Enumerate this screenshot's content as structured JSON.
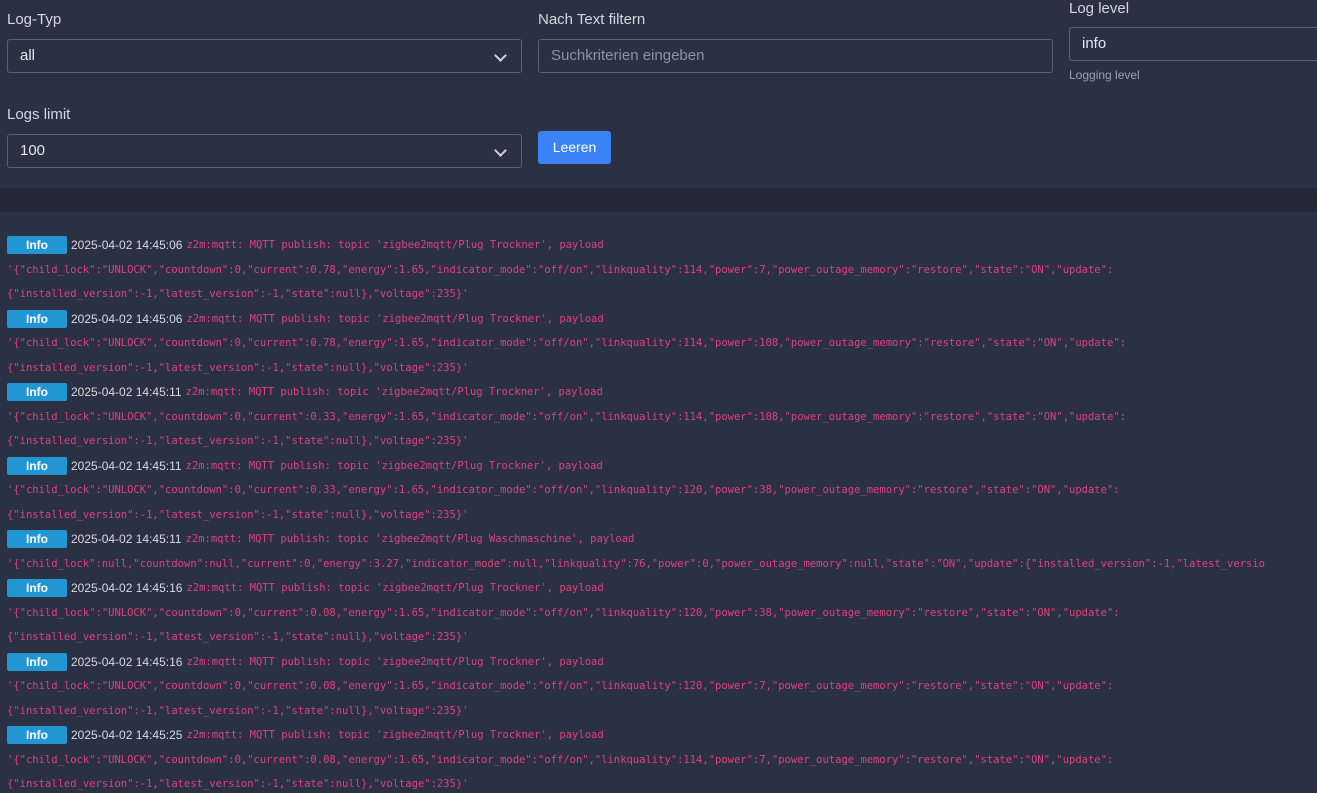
{
  "filters": {
    "log_type": {
      "label": "Log-Typ",
      "value": "all"
    },
    "text_filter": {
      "label": "Nach Text filtern",
      "placeholder": "Suchkriterien eingeben"
    },
    "log_level": {
      "label": "Log level",
      "value": "info",
      "help": "Logging level"
    },
    "logs_limit": {
      "label": "Logs limit",
      "value": "100"
    },
    "clear_button": "Leeren"
  },
  "logs": [
    {
      "level": "Info",
      "time": "2025-04-02 14:45:06",
      "message": "z2m:mqtt: MQTT publish: topic 'zigbee2mqtt/Plug Trockner', payload",
      "payload1": "'{\"child_lock\":\"UNLOCK\",\"countdown\":0,\"current\":0.78,\"energy\":1.65,\"indicator_mode\":\"off/on\",\"linkquality\":114,\"power\":7,\"power_outage_memory\":\"restore\",\"state\":\"ON\",\"update\":",
      "payload2": "{\"installed_version\":-1,\"latest_version\":-1,\"state\":null},\"voltage\":235}'"
    },
    {
      "level": "Info",
      "time": "2025-04-02 14:45:06",
      "message": "z2m:mqtt: MQTT publish: topic 'zigbee2mqtt/Plug Trockner', payload",
      "payload1": "'{\"child_lock\":\"UNLOCK\",\"countdown\":0,\"current\":0.78,\"energy\":1.65,\"indicator_mode\":\"off/on\",\"linkquality\":114,\"power\":108,\"power_outage_memory\":\"restore\",\"state\":\"ON\",\"update\":",
      "payload2": "{\"installed_version\":-1,\"latest_version\":-1,\"state\":null},\"voltage\":235}'"
    },
    {
      "level": "Info",
      "time": "2025-04-02 14:45:11",
      "message": "z2m:mqtt: MQTT publish: topic 'zigbee2mqtt/Plug Trockner', payload",
      "payload1": "'{\"child_lock\":\"UNLOCK\",\"countdown\":0,\"current\":0.33,\"energy\":1.65,\"indicator_mode\":\"off/on\",\"linkquality\":114,\"power\":108,\"power_outage_memory\":\"restore\",\"state\":\"ON\",\"update\":",
      "payload2": "{\"installed_version\":-1,\"latest_version\":-1,\"state\":null},\"voltage\":235}'"
    },
    {
      "level": "Info",
      "time": "2025-04-02 14:45:11",
      "message": "z2m:mqtt: MQTT publish: topic 'zigbee2mqtt/Plug Trockner', payload",
      "payload1": "'{\"child_lock\":\"UNLOCK\",\"countdown\":0,\"current\":0.33,\"energy\":1.65,\"indicator_mode\":\"off/on\",\"linkquality\":120,\"power\":38,\"power_outage_memory\":\"restore\",\"state\":\"ON\",\"update\":",
      "payload2": "{\"installed_version\":-1,\"latest_version\":-1,\"state\":null},\"voltage\":235}'"
    },
    {
      "level": "Info",
      "time": "2025-04-02 14:45:11",
      "message": "z2m:mqtt: MQTT publish: topic 'zigbee2mqtt/Plug Waschmaschine', payload",
      "payload1": "'{\"child_lock\":null,\"countdown\":null,\"current\":0,\"energy\":3.27,\"indicator_mode\":null,\"linkquality\":76,\"power\":0,\"power_outage_memory\":null,\"state\":\"ON\",\"update\":{\"installed_version\":-1,\"latest_versio",
      "payload2": ""
    },
    {
      "level": "Info",
      "time": "2025-04-02 14:45:16",
      "message": "z2m:mqtt: MQTT publish: topic 'zigbee2mqtt/Plug Trockner', payload",
      "payload1": "'{\"child_lock\":\"UNLOCK\",\"countdown\":0,\"current\":0.08,\"energy\":1.65,\"indicator_mode\":\"off/on\",\"linkquality\":120,\"power\":38,\"power_outage_memory\":\"restore\",\"state\":\"ON\",\"update\":",
      "payload2": "{\"installed_version\":-1,\"latest_version\":-1,\"state\":null},\"voltage\":235}'"
    },
    {
      "level": "Info",
      "time": "2025-04-02 14:45:16",
      "message": "z2m:mqtt: MQTT publish: topic 'zigbee2mqtt/Plug Trockner', payload",
      "payload1": "'{\"child_lock\":\"UNLOCK\",\"countdown\":0,\"current\":0.08,\"energy\":1.65,\"indicator_mode\":\"off/on\",\"linkquality\":120,\"power\":7,\"power_outage_memory\":\"restore\",\"state\":\"ON\",\"update\":",
      "payload2": "{\"installed_version\":-1,\"latest_version\":-1,\"state\":null},\"voltage\":235}'"
    },
    {
      "level": "Info",
      "time": "2025-04-02 14:45:25",
      "message": "z2m:mqtt: MQTT publish: topic 'zigbee2mqtt/Plug Trockner', payload",
      "payload1": "'{\"child_lock\":\"UNLOCK\",\"countdown\":0,\"current\":0.08,\"energy\":1.65,\"indicator_mode\":\"off/on\",\"linkquality\":114,\"power\":7,\"power_outage_memory\":\"restore\",\"state\":\"ON\",\"update\":",
      "payload2": "{\"installed_version\":-1,\"latest_version\":-1,\"state\":null},\"voltage\":235}'"
    }
  ],
  "colors": {
    "accent": "#3b82f6",
    "badge": "#2196d3",
    "payload": "#e0407e"
  }
}
